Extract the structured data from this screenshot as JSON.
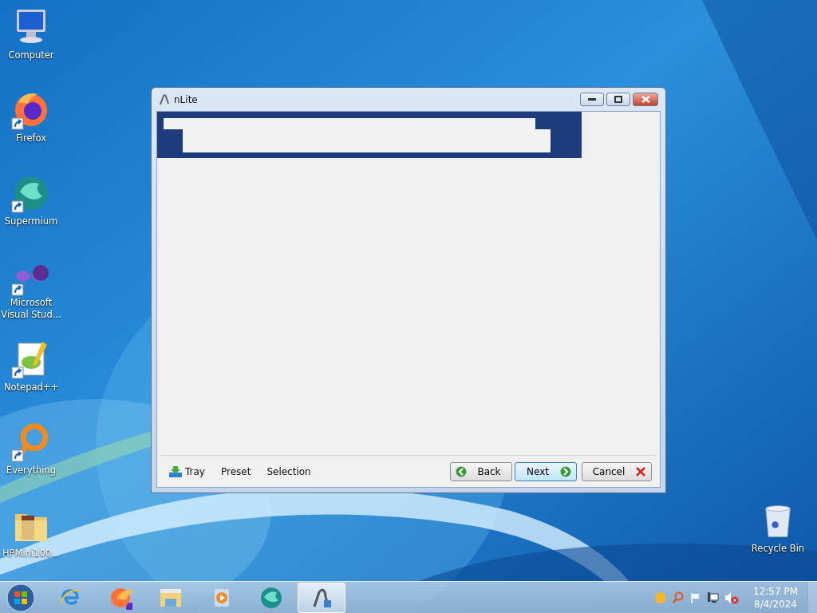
{
  "desktop_icons": [
    {
      "kind": "computer",
      "label": "Computer",
      "shortcut": false
    },
    {
      "kind": "firefox",
      "label": "Firefox",
      "shortcut": true
    },
    {
      "kind": "supermium",
      "label": "Supermium",
      "shortcut": true
    },
    {
      "kind": "vs",
      "label": "Microsoft Visual Stud...",
      "shortcut": true
    },
    {
      "kind": "notepad",
      "label": "Notepad++",
      "shortcut": true
    },
    {
      "kind": "everything",
      "label": "Everything",
      "shortcut": true
    },
    {
      "kind": "folder",
      "label": "HPMini100...",
      "shortcut": false
    }
  ],
  "recycle_bin": {
    "label": "Recycle Bin"
  },
  "window": {
    "title": "nLite",
    "footer_links": [
      "Tray",
      "Preset",
      "Selection"
    ],
    "buttons": [
      {
        "kind": "back",
        "label": "Back",
        "default": false
      },
      {
        "kind": "next",
        "label": "Next",
        "default": true
      },
      {
        "kind": "cancel",
        "label": "Cancel",
        "default": false
      }
    ]
  },
  "taskbar": {
    "apps": [
      {
        "kind": "ie",
        "selected": false
      },
      {
        "kind": "firefox",
        "selected": false
      },
      {
        "kind": "explorer",
        "selected": false
      },
      {
        "kind": "media",
        "selected": false
      },
      {
        "kind": "supermium",
        "selected": false
      },
      {
        "kind": "nlite",
        "selected": true
      }
    ],
    "time": "12:57 PM",
    "date": "8/4/2024"
  }
}
